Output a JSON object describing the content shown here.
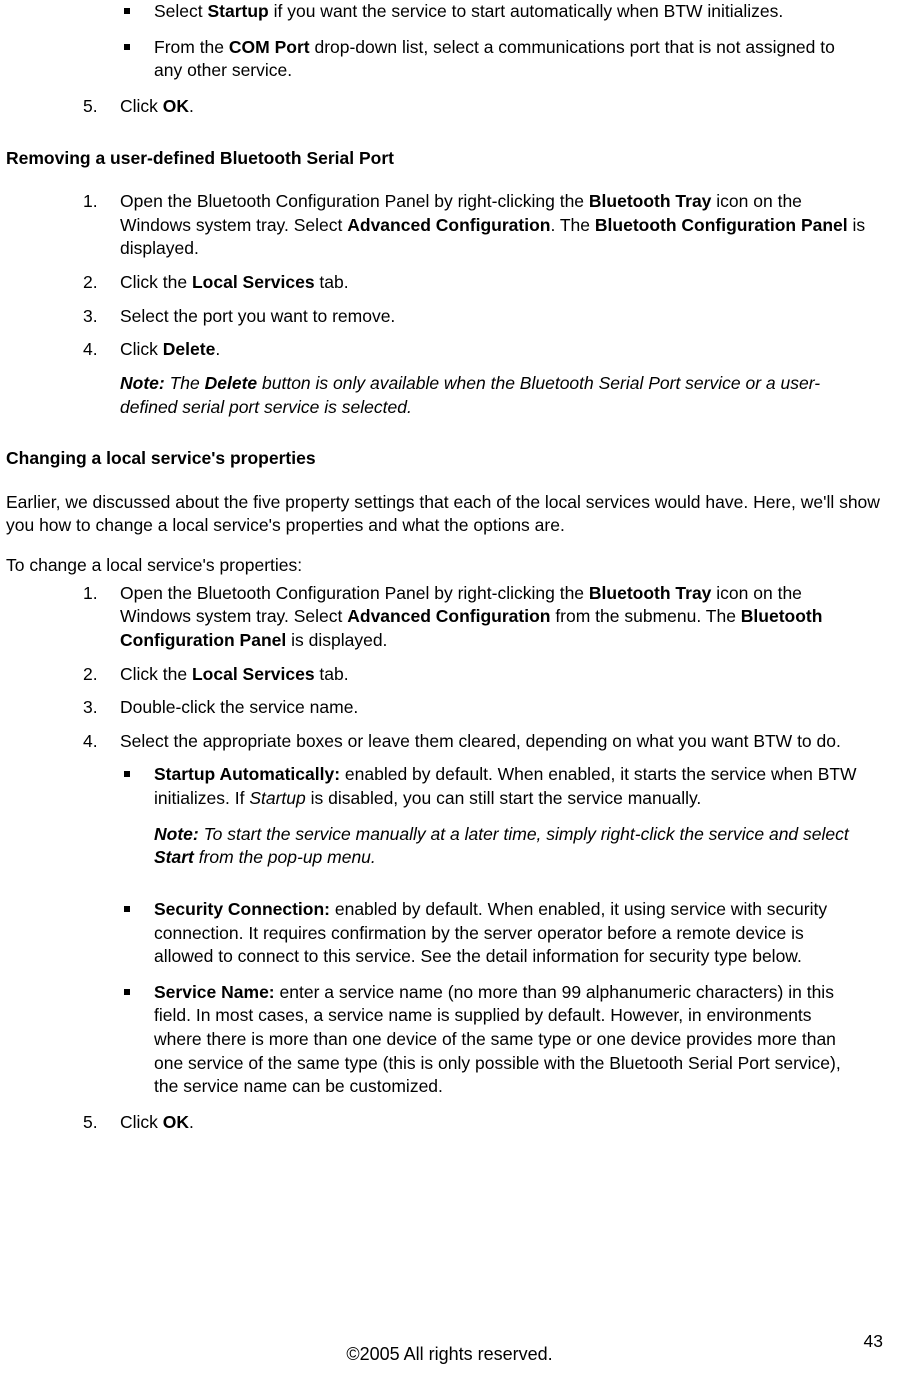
{
  "intro_bullets": {
    "b1_pre": "Select ",
    "b1_bold": "Startup",
    "b1_post": " if you want the service to start automatically when BTW initializes.",
    "b2_pre": "From the ",
    "b2_bold": "COM Port",
    "b2_post": " drop-down list, select a communications port that is not assigned to any other service."
  },
  "intro_step5_num": "5.",
  "intro_step5_pre": "Click ",
  "intro_step5_bold": "OK",
  "intro_step5_post": ".",
  "heading_remove": "Removing a user-defined Bluetooth Serial Port",
  "remove": {
    "n1": "1.",
    "s1_a": "Open the Bluetooth Configuration Panel by right-clicking the ",
    "s1_b1": "Bluetooth Tray",
    "s1_c": " icon on the Windows system tray. Select ",
    "s1_b2": "Advanced Configuration",
    "s1_d": ". The ",
    "s1_b3": "Bluetooth Configuration Panel",
    "s1_e": " is displayed.",
    "n2": "2.",
    "s2_a": "Click the ",
    "s2_b": "Local Services",
    "s2_c": " tab.",
    "n3": "3.",
    "s3": "Select the port you want to remove.",
    "n4": "4.",
    "s4_a": "Click ",
    "s4_b": "Delete",
    "s4_c": ".",
    "note_lbl": "Note:",
    "note_a": " The ",
    "note_b": "Delete",
    "note_c": " button is only available when the Bluetooth Serial Port service or a user-defined serial port service is selected."
  },
  "heading_change": "Changing a local service's properties",
  "change_intro": "Earlier, we discussed about the five property settings that each of the local services would have. Here, we'll show you how to change a local service's properties and what the options are.",
  "change_lead": "To change a local service's properties:",
  "change": {
    "n1": "1.",
    "s1_a": "Open the Bluetooth Configuration Panel by right-clicking the ",
    "s1_b1": "Bluetooth Tray",
    "s1_c": " icon on the Windows system tray. Select ",
    "s1_b2": "Advanced Configuration",
    "s1_d": " from the submenu. The ",
    "s1_b3": "Bluetooth Configuration Panel",
    "s1_e": " is displayed.",
    "n2": "2.",
    "s2_a": "Click the ",
    "s2_b": "Local Services",
    "s2_c": " tab.",
    "n3": "3.",
    "s3": "Double-click the service name.",
    "n4": "4.",
    "s4": "Select the appropriate boxes or leave them cleared, depending on what you want BTW to do.",
    "sub1_b": "Startup Automatically:",
    "sub1_a": " enabled by default. When enabled, it starts the service when BTW initializes. If ",
    "sub1_i": "Startup",
    "sub1_c": " is disabled, you can still start the service manually.",
    "sub1_note_lbl": "Note:",
    "sub1_note_a": " To start the service manually at a later time, simply right-click the service and select ",
    "sub1_note_b": "Start",
    "sub1_note_c": " from the pop-up menu.",
    "sub2_b": "Security Connection:",
    "sub2_t": " enabled by default. When enabled, it using service with security connection. It requires confirmation by the server operator before a remote device is allowed to connect to this service. See the detail information for security type below.",
    "sub3_b": "Service Name:",
    "sub3_t": " enter a service name (no more than 99 alphanumeric characters) in this field. In most cases, a service name is supplied by default. However, in environments where there is more than one device of the same type or one device provides more than one service of the same type (this is only possible with the Bluetooth Serial Port service), the service name can be customized.",
    "n5": "5.",
    "s5_a": "Click ",
    "s5_b": "OK",
    "s5_c": "."
  },
  "footer": "©2005 All rights reserved.",
  "page_num": "43"
}
